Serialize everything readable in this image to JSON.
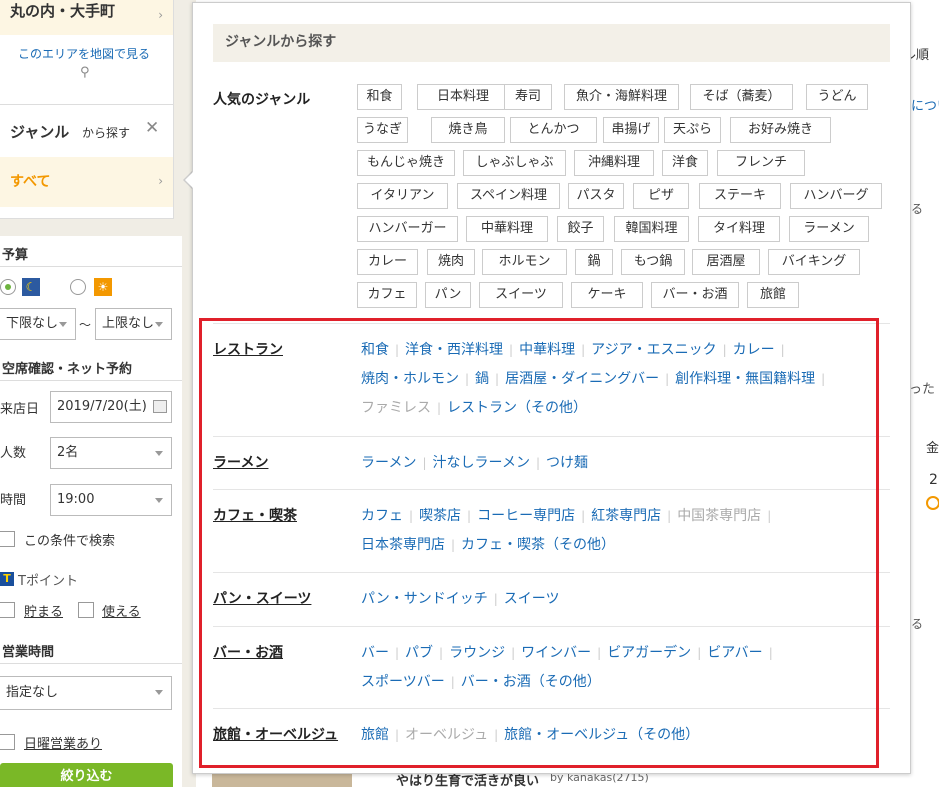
{
  "sidebar": {
    "area_title": "丸の内・大手町",
    "map_link": "このエリアを地図で見る",
    "genre_title": "ジャンル",
    "genre_suffix": "から探す",
    "genre_value": "すべて",
    "budget_label": "予算",
    "budget_min": "下限なし",
    "budget_tilde": "〜",
    "budget_max": "上限なし",
    "reserve_label": "空席確認・ネット予約",
    "date_label": "来店日",
    "date_value": "2019/7/20(土)",
    "people_label": "人数",
    "people_value": "2名",
    "time_label": "時間",
    "time_value": "19:00",
    "search_condition": "この条件で検索",
    "tpoint_label": "Tポイント",
    "tpoint_save": "貯まる",
    "tpoint_use": "使える",
    "hours_label": "営業時間",
    "hours_value": "指定なし",
    "sunday_open": "日曜営業あり",
    "filter_button": "絞り込む"
  },
  "popup": {
    "header": "ジャンルから探す",
    "popular_label": "人気のジャンル",
    "popular_tags": [
      [
        "和食",
        "日本料理",
        "寿司",
        "魚介・海鮮料理",
        "そば（蕎麦）",
        "うどん"
      ],
      [
        "うなぎ",
        "焼き鳥",
        "とんかつ",
        "串揚げ",
        "天ぷら",
        "お好み焼き"
      ],
      [
        "もんじゃ焼き",
        "しゃぶしゃぶ",
        "沖縄料理",
        "洋食",
        "フレンチ"
      ],
      [
        "イタリアン",
        "スペイン料理",
        "パスタ",
        "ピザ",
        "ステーキ",
        "ハンバーグ"
      ],
      [
        "ハンバーガー",
        "中華料理",
        "餃子",
        "韓国料理",
        "タイ料理",
        "ラーメン"
      ],
      [
        "カレー",
        "焼肉",
        "ホルモン",
        "鍋",
        "もつ鍋",
        "居酒屋",
        "バイキング"
      ],
      [
        "カフェ",
        "パン",
        "スイーツ",
        "ケーキ",
        "バー・お酒",
        "旅館"
      ]
    ],
    "categories": [
      {
        "title": "レストラン",
        "rows": [
          [
            {
              "t": "和食"
            },
            {
              "t": "洋食・西洋料理"
            },
            {
              "t": "中華料理"
            },
            {
              "t": "アジア・エスニック"
            },
            {
              "t": "カレー"
            }
          ],
          [
            {
              "t": "焼肉・ホルモン"
            },
            {
              "t": "鍋"
            },
            {
              "t": "居酒屋・ダイニングバー"
            },
            {
              "t": "創作料理・無国籍料理"
            }
          ],
          [
            {
              "t": "ファミレス",
              "disabled": true
            },
            {
              "t": "レストラン（その他）"
            }
          ]
        ]
      },
      {
        "title": "ラーメン",
        "rows": [
          [
            {
              "t": "ラーメン"
            },
            {
              "t": "汁なしラーメン"
            },
            {
              "t": "つけ麺"
            }
          ]
        ]
      },
      {
        "title": "カフェ・喫茶",
        "rows": [
          [
            {
              "t": "カフェ"
            },
            {
              "t": "喫茶店"
            },
            {
              "t": "コーヒー専門店"
            },
            {
              "t": "紅茶専門店"
            },
            {
              "t": "中国茶専門店",
              "disabled": true
            }
          ],
          [
            {
              "t": "日本茶専門店"
            },
            {
              "t": "カフェ・喫茶（その他）"
            }
          ]
        ]
      },
      {
        "title": "パン・スイーツ",
        "rows": [
          [
            {
              "t": "パン・サンドイッチ"
            },
            {
              "t": "スイーツ"
            }
          ]
        ]
      },
      {
        "title": "バー・お酒",
        "rows": [
          [
            {
              "t": "バー"
            },
            {
              "t": "パブ"
            },
            {
              "t": "ラウンジ"
            },
            {
              "t": "ワインバー"
            },
            {
              "t": "ビアガーデン"
            },
            {
              "t": "ビアバー"
            }
          ],
          [
            {
              "t": "スポーツバー"
            },
            {
              "t": "バー・お酒（その他）"
            }
          ]
        ]
      },
      {
        "title": "旅館・オーベルジュ",
        "rows": [
          [
            {
              "t": "旅館"
            },
            {
              "t": "オーベルジュ",
              "disabled": true
            },
            {
              "t": "旅館・オーベルジュ（その他）"
            }
          ]
        ]
      }
    ]
  },
  "background": {
    "sort_fragment": "ル順",
    "link_fragment": "につい",
    "fragment_ru1": "る",
    "fragment_tta": "った",
    "fragment_kin": "金",
    "fragment_2": "2.",
    "fragment_ru2": "る",
    "review_title": "やはり生育で活きが良い",
    "review_by": "by kanakas(2715)"
  },
  "colors": {
    "link": "#1a6bb5",
    "highlight_box": "#e0202a",
    "accent_orange": "#f39800",
    "filter_button": "#7ab827"
  }
}
